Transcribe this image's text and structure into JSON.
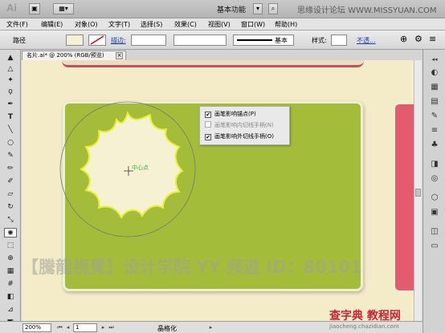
{
  "app": {
    "logo": "Ai",
    "workspace_label": "基本功能",
    "watermark_top": "思缘设计论坛 WWW.MISSYUAN.COM"
  },
  "menu": [
    "文件(F)",
    "编辑(E)",
    "对象(O)",
    "文字(T)",
    "选择(S)",
    "效果(C)",
    "视图(V)",
    "窗口(W)",
    "帮助(H)"
  ],
  "control": {
    "selection_label": "路径",
    "stroke_label": "描边:",
    "style_label": "基本",
    "style2_label": "样式:",
    "opacity_label": "不透..."
  },
  "document": {
    "tab_title": "名片.ai* @ 200% (RGB/预览)"
  },
  "canvas": {
    "center_label": "中心点",
    "big_watermark": "【騰龍視覺】设计学院  YY 频道 ID：80101"
  },
  "popup": {
    "options": [
      {
        "label": "画笔影响锚点(P)",
        "checked": true,
        "enabled": true
      },
      {
        "label": "画笔影响内切线手柄(N)",
        "checked": false,
        "enabled": false
      },
      {
        "label": "画笔影响外切线手柄(O)",
        "checked": true,
        "enabled": true
      }
    ]
  },
  "status": {
    "zoom": "200%",
    "page": "1",
    "tool": "晶格化"
  },
  "footer_mark": {
    "title": "查字典 教程网",
    "url": "jiaocheng.chazidian.com"
  },
  "colors": {
    "canvas_bg": "#f4ecc9",
    "green_card": "#a3bd3b",
    "red_card": "#e35c6e",
    "blob_fill": "#f7f1d3",
    "blob_stroke": "#e8f030"
  }
}
